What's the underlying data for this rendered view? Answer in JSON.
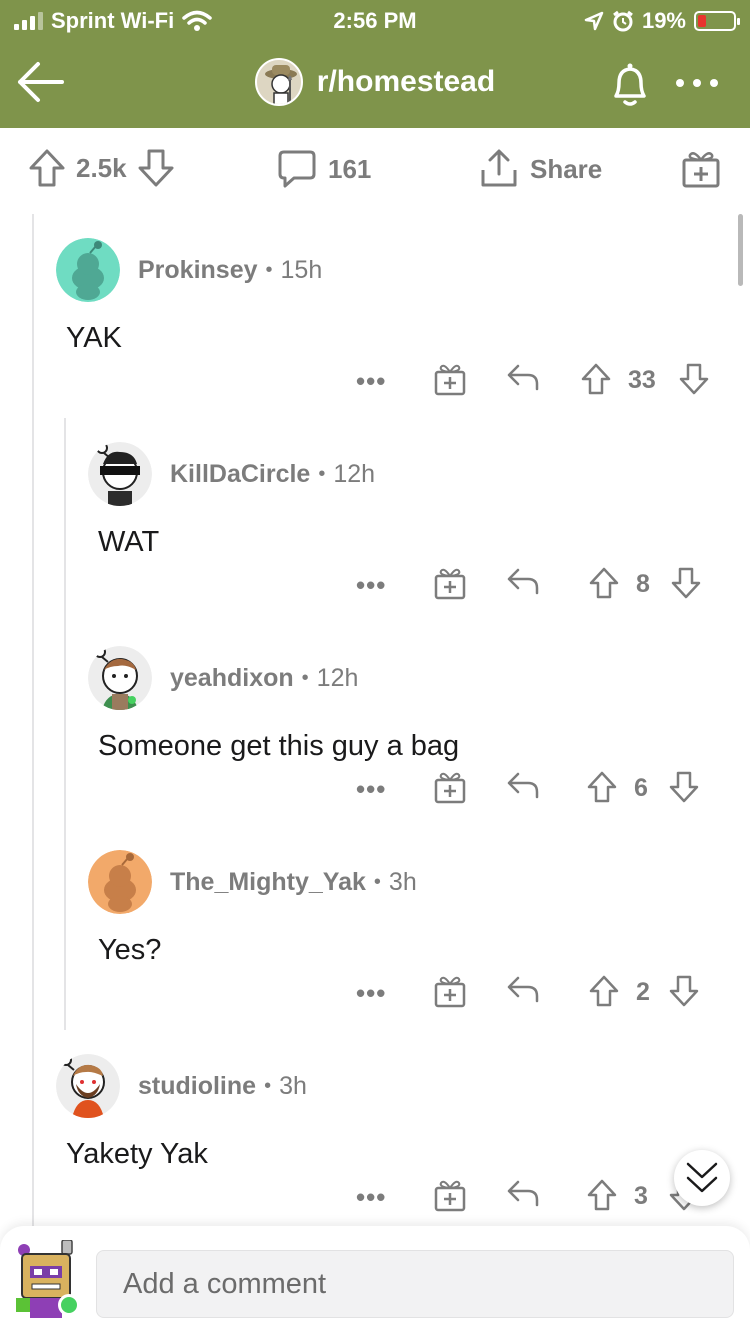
{
  "status_bar": {
    "carrier": "Sprint Wi-Fi",
    "time": "2:56 PM",
    "battery": "19%"
  },
  "header": {
    "subreddit": "r/homestead",
    "brand_color": "#7f944b"
  },
  "post_actions": {
    "votes": "2.5k",
    "comments": "161",
    "share": "Share"
  },
  "comments": [
    {
      "user": "Prokinsey",
      "age": "15h",
      "body": "YAK",
      "score": "33"
    },
    {
      "user": "KillDaCircle",
      "age": "12h",
      "body": "WAT",
      "score": "8"
    },
    {
      "user": "yeahdixon",
      "age": "12h",
      "body": "Someone get this guy a bag",
      "score": "6"
    },
    {
      "user": "The_Mighty_Yak",
      "age": "3h",
      "body": "Yes?",
      "score": "2"
    },
    {
      "user": "studioline",
      "age": "3h",
      "body": "Yakety Yak",
      "score": "3"
    }
  ],
  "comment_box": {
    "placeholder": "Add a comment"
  },
  "icons": [
    "back-arrow-icon",
    "bell-icon",
    "more-icon",
    "upvote-icon",
    "downvote-icon",
    "comment-icon",
    "share-icon",
    "award-icon",
    "reply-icon",
    "collapse-chevrons-icon"
  ]
}
